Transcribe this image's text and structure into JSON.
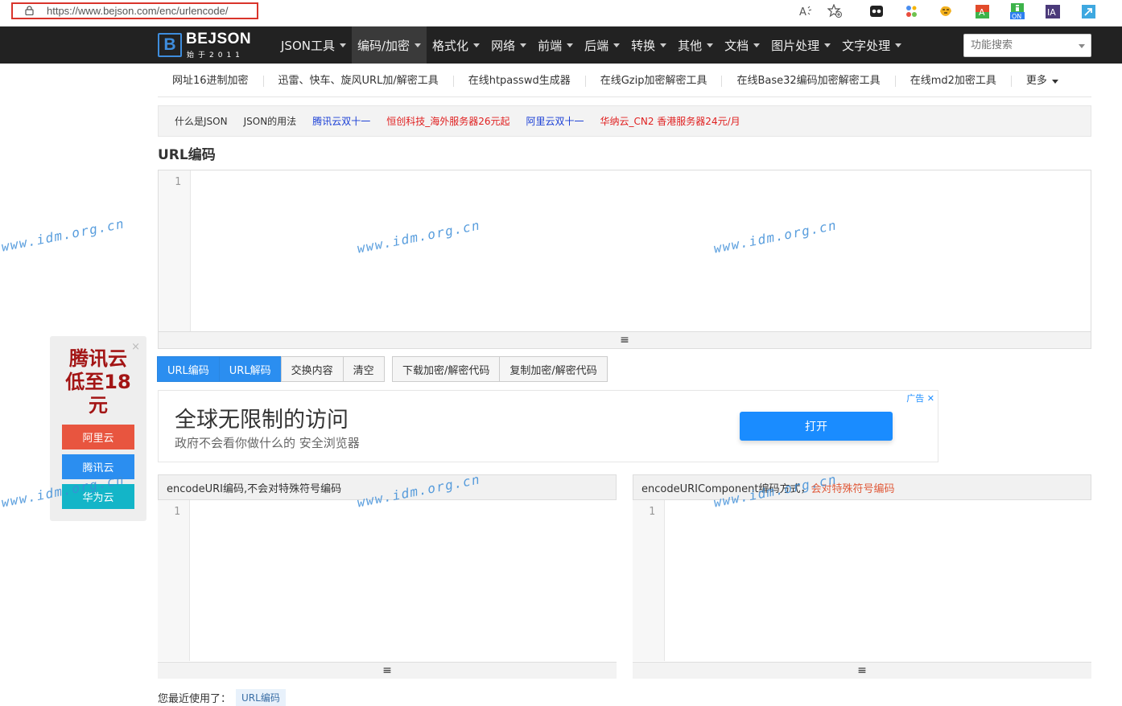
{
  "browser": {
    "url": "https://www.bejson.com/enc/urlencode/",
    "icons": [
      "lock-icon",
      "read-aloud-icon",
      "favorites-icon",
      "extension-dots-icon",
      "extension-colorful-icon",
      "extension-tiger-icon",
      "extension-a-icon",
      "extension-on-icon",
      "extension-ia-icon",
      "extension-arrow-icon"
    ],
    "ext_labels": {
      "ia": "IA",
      "on": "ON",
      "a": "A"
    }
  },
  "logo": {
    "mark": "B",
    "name": "BEJSON",
    "slogan": "始于2011"
  },
  "nav": {
    "items": [
      {
        "label": "JSON工具",
        "active": false
      },
      {
        "label": "编码/加密",
        "active": true
      },
      {
        "label": "格式化",
        "active": false
      },
      {
        "label": "网络",
        "active": false
      },
      {
        "label": "前端",
        "active": false
      },
      {
        "label": "后端",
        "active": false
      },
      {
        "label": "转换",
        "active": false
      },
      {
        "label": "其他",
        "active": false
      },
      {
        "label": "文档",
        "active": false
      },
      {
        "label": "图片处理",
        "active": false
      },
      {
        "label": "文字处理",
        "active": false
      }
    ],
    "search_placeholder": "功能搜索"
  },
  "subnav": [
    "网址16进制加密",
    "迅雷、快车、旋风URL加/解密工具",
    "在线htpasswd生成器",
    "在线Gzip加密解密工具",
    "在线Base32编码加密解密工具",
    "在线md2加密工具",
    "更多"
  ],
  "infobar": [
    {
      "label": "什么是JSON",
      "color": "#333333"
    },
    {
      "label": "JSON的用法",
      "color": "#333333"
    },
    {
      "label": "腾讯云双十一",
      "color": "#1a3fd6"
    },
    {
      "label": "恒创科技_海外服务器26元起",
      "color": "#e02020"
    },
    {
      "label": "阿里云双十一",
      "color": "#1a3fd6"
    },
    {
      "label": "华纳云_CN2 香港服务器24元/月",
      "color": "#e02020"
    }
  ],
  "section_title": "URL编码",
  "main_editor": {
    "line": "1"
  },
  "buttons": {
    "group1": [
      {
        "label": "URL编码",
        "primary": true
      },
      {
        "label": "URL解码",
        "primary": true
      },
      {
        "label": "交换内容",
        "primary": false
      },
      {
        "label": "清空",
        "primary": false
      }
    ],
    "group2": [
      {
        "label": "下载加密/解密代码",
        "primary": false
      },
      {
        "label": "复制加密/解密代码",
        "primary": false
      }
    ]
  },
  "ad": {
    "title": "全球无限制的访问",
    "subtitle": "政府不会看你做什么的 安全浏览器",
    "button": "打开",
    "tag": "广告 ✕"
  },
  "panels": {
    "left": {
      "title": "encodeURI编码,不会对特殊符号编码",
      "line": "1"
    },
    "right": {
      "title": "encodeURIComponent编码方式，",
      "title_red": "会对特殊符号编码",
      "line": "1"
    }
  },
  "recent": {
    "label": "您最近使用了：",
    "item": "URL编码"
  },
  "float_ad": {
    "lines": [
      "腾讯云",
      "低至18",
      "元"
    ],
    "close": "×",
    "buttons": [
      {
        "label": "阿里云",
        "color": "#e8553f"
      },
      {
        "label": "腾讯云",
        "color": "#2b8ef0"
      },
      {
        "label": "华为云",
        "color": "#13b5c8"
      }
    ]
  },
  "watermark": "www.idm.org.cn"
}
